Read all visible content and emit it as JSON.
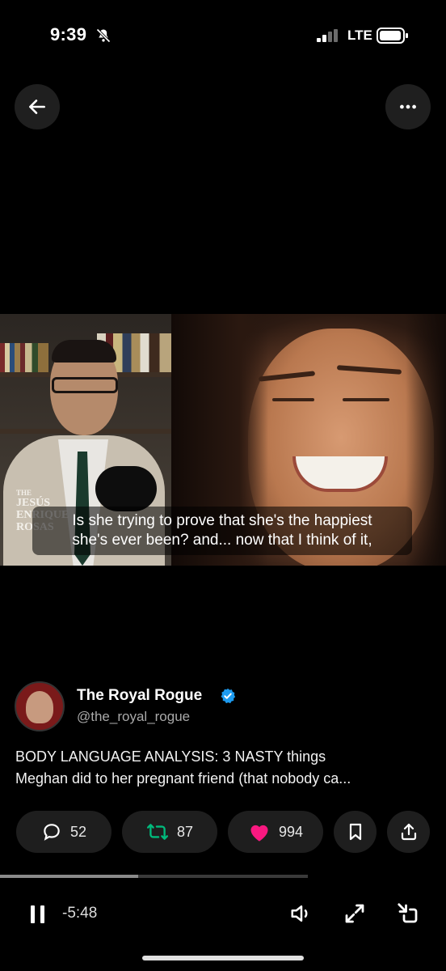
{
  "status_bar": {
    "time": "9:39",
    "network": "LTE",
    "icons": [
      "bell-slash-icon",
      "signal-icon",
      "battery-icon"
    ]
  },
  "top_bar": {
    "back_icon": "arrow-left-icon",
    "more_icon": "more-horizontal-icon"
  },
  "video": {
    "overlay_brand_lines": [
      "THE",
      "JESÚS",
      "ENRIQUE",
      "ROSAS"
    ],
    "caption_line1": "Is she trying to prove that she's the happiest",
    "caption_line2": "she's ever been? and... now that I think of it,"
  },
  "post": {
    "author_name": "The Royal Rogue",
    "author_handle": "@the_royal_rogue",
    "verified": true,
    "text_line1": "BODY LANGUAGE ANALYSIS: 3 NASTY things",
    "text_line2": "Meghan did to her pregnant friend (that nobody ca..."
  },
  "actions": {
    "replies": "52",
    "reposts": "87",
    "likes": "994",
    "icons": [
      "reply-icon",
      "repost-icon",
      "heart-icon",
      "bookmark-icon",
      "share-icon"
    ]
  },
  "player": {
    "time_remaining": "-5:48",
    "progress_fraction": 0.31,
    "buffered_fraction": 0.69
  },
  "colors": {
    "background": "#000000",
    "repost_green": "#00ba7c",
    "like_pink": "#f91880",
    "verified_blue": "#1d9bf0",
    "pill_bg": "#1e1e1e"
  }
}
